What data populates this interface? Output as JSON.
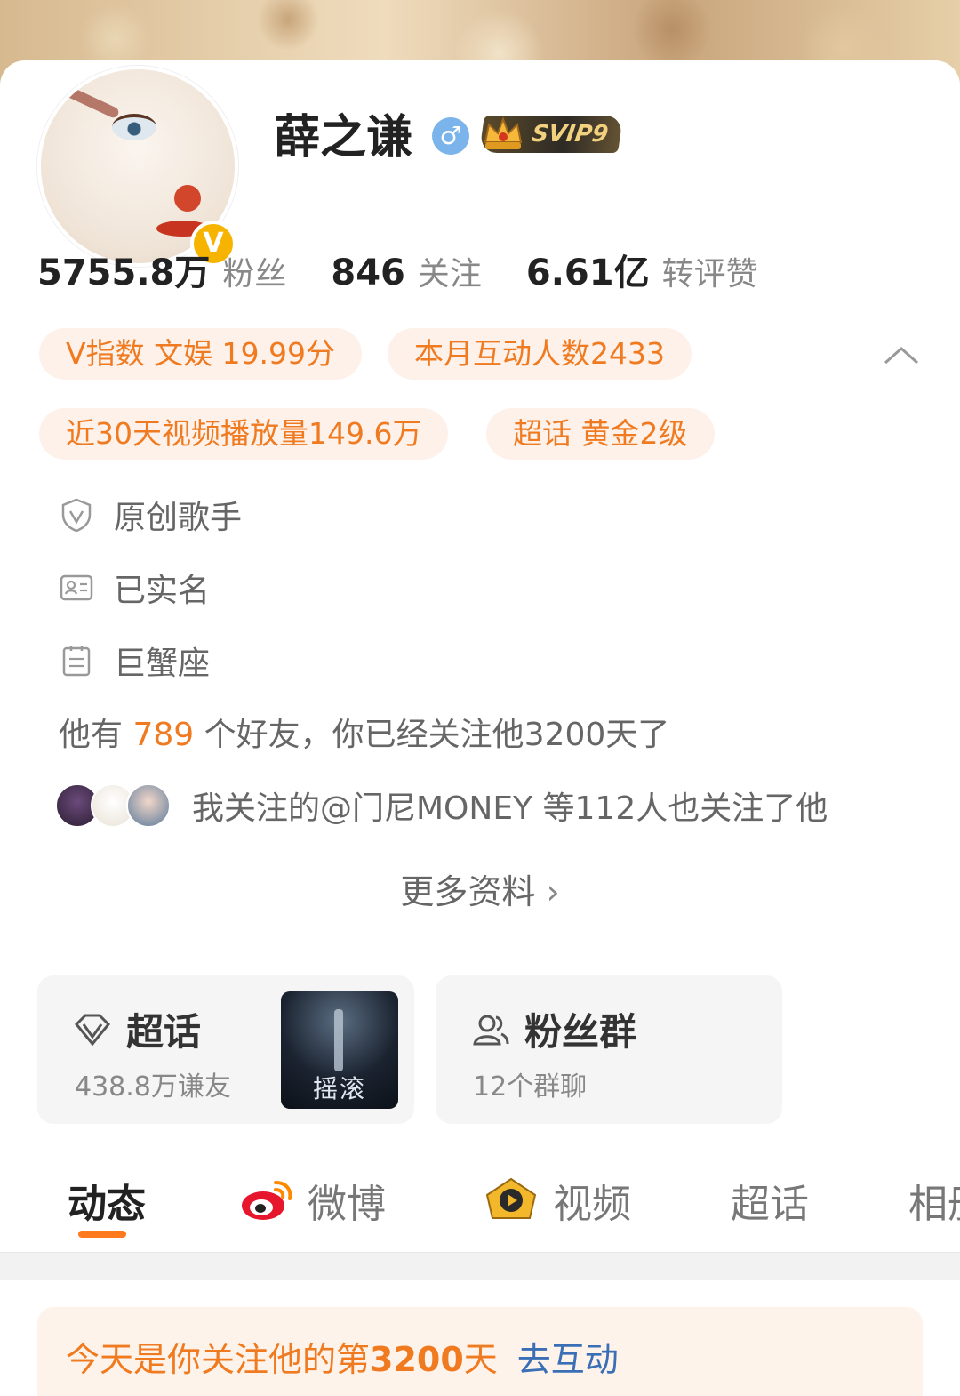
{
  "profile": {
    "name": "薛之谦",
    "gender_symbol": "♂",
    "vip_label": "SVIP9",
    "verified_symbol": "V"
  },
  "stats": [
    {
      "num": "5755.8万",
      "label": "粉丝"
    },
    {
      "num": "846",
      "label": "关注"
    },
    {
      "num": "6.61亿",
      "label": "转评赞"
    }
  ],
  "tags": [
    "V指数 文娱 19.99分",
    "本月互动人数2433",
    "近30天视频播放量149.6万",
    "超话 黄金2级"
  ],
  "info": [
    "原创歌手",
    "已实名",
    "巨蟹座"
  ],
  "friends": {
    "prefix": "他有",
    "count": "789",
    "suffix": "个好友，你已经关注他3200天了"
  },
  "mutual_text": "我关注的@门尼MONEY 等112人也关注了他",
  "more_label": "更多资料",
  "supertopic": {
    "title": "超话",
    "sub": "438.8万谦友",
    "cover_text": "摇滚"
  },
  "fangroup": {
    "title": "粉丝群",
    "sub": "12个群聊"
  },
  "tabs": [
    "动态",
    "微博",
    "视频",
    "超话",
    "相册"
  ],
  "notice": {
    "prefix": "今天是你关注他的第",
    "days": "3200",
    "suffix": "天",
    "link": "去互动"
  },
  "colors": {
    "accent": "#f07a20",
    "tag_bg": "#fdf1ea",
    "link": "#3a6fb6",
    "underline": "#ff7a1c"
  }
}
